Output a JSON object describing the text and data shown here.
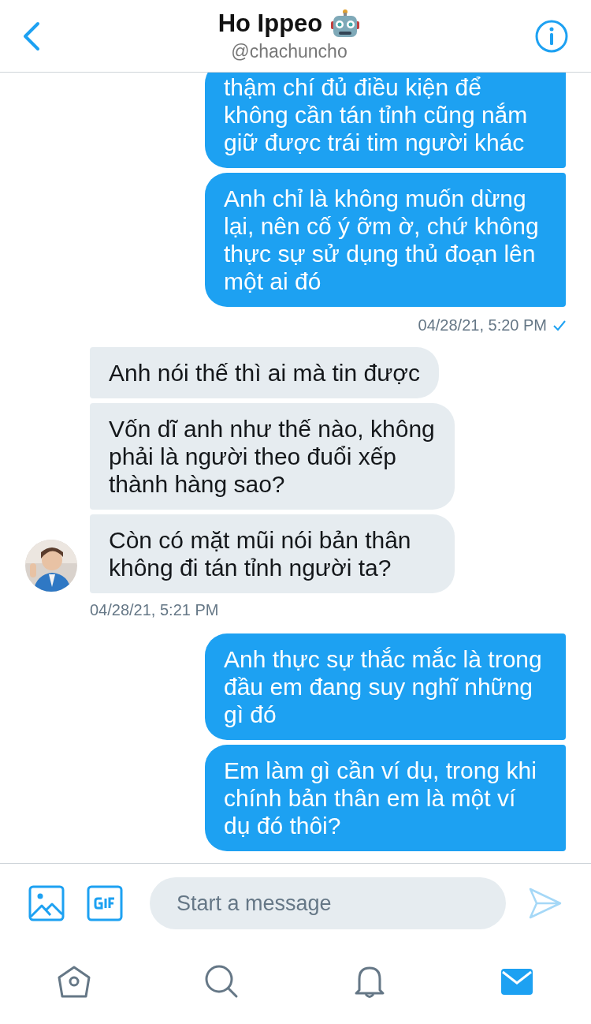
{
  "header": {
    "title": "Ho Ippeo",
    "handle": "@chachuncho"
  },
  "messages": [
    {
      "kind": "sent",
      "text": "thậm chí đủ điều kiện để không cần tán tỉnh cũng nắm giữ được trái tim người khác",
      "avatar": false
    },
    {
      "kind": "sent",
      "text": "Anh chỉ là không muốn dừng lại, nên cố ý ỡm ờ, chứ không thực sự sử dụng thủ đoạn lên một ai đó",
      "avatar": false
    },
    {
      "kind": "sent_time",
      "text": "04/28/21, 5:20 PM",
      "read": true
    },
    {
      "kind": "received",
      "text": "Anh nói thế thì ai mà tin được",
      "avatar": false
    },
    {
      "kind": "received",
      "text": "Vốn dĩ anh như thế nào, không phải là người theo đuổi xếp thành hàng sao?",
      "avatar": false
    },
    {
      "kind": "received",
      "text": "Còn có mặt mũi nói bản thân không đi tán tỉnh người ta?",
      "avatar": true
    },
    {
      "kind": "received_time",
      "text": "04/28/21, 5:21 PM",
      "read": false
    },
    {
      "kind": "sent",
      "text": "Anh thực sự thắc mắc là trong đầu em đang suy nghĩ những gì đó",
      "avatar": false
    },
    {
      "kind": "sent",
      "text": "Em làm gì cần ví dụ, trong khi chính bản thân em là một ví dụ đó thôi?",
      "avatar": false
    }
  ],
  "composer": {
    "placeholder": "Start a message"
  },
  "nav": [
    {
      "kind": "home",
      "selected": false
    },
    {
      "kind": "search",
      "selected": false
    },
    {
      "kind": "notifications",
      "selected": false
    },
    {
      "kind": "messages",
      "selected": true
    }
  ]
}
